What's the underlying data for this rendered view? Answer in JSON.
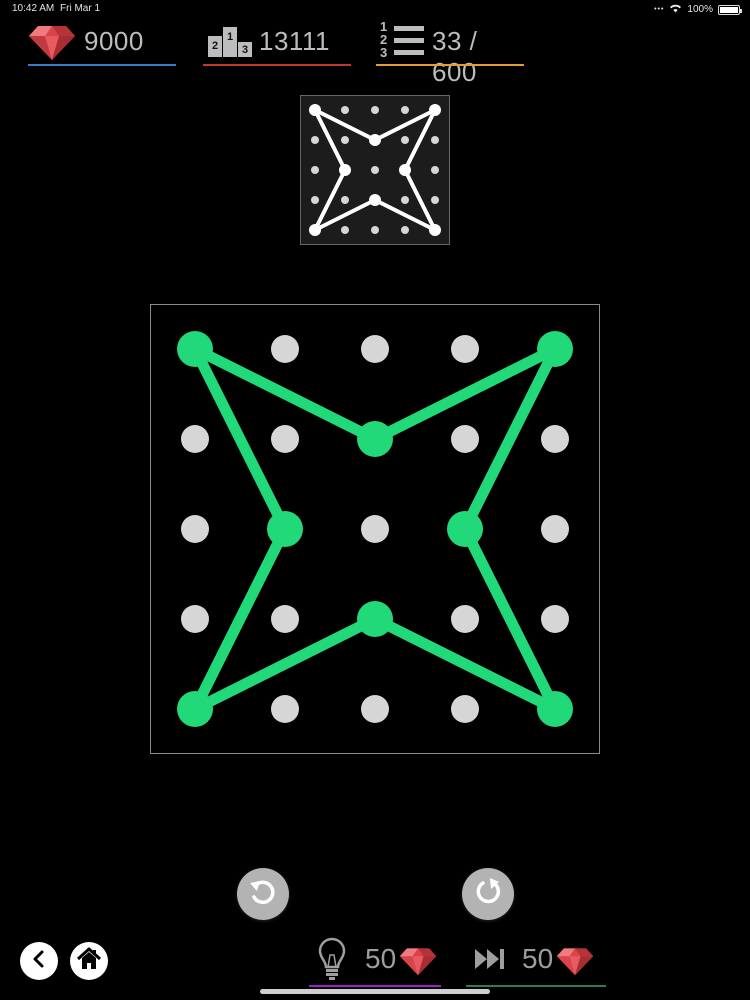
{
  "status_bar": {
    "time": "10:42 AM",
    "date": "Fri Mar 1",
    "battery": "100%",
    "battery_level": 1.0
  },
  "stats": {
    "gems": {
      "value": "9000",
      "underline_color": "#3a78c8"
    },
    "score": {
      "value": "13111",
      "underline_color": "#c0392b",
      "podium": [
        "2",
        "1",
        "3"
      ]
    },
    "level": {
      "value": "33 / 600",
      "underline_color": "#e0a030",
      "list_numbers": [
        "1",
        "2",
        "3"
      ]
    }
  },
  "puzzle": {
    "grid_size": 5,
    "dot_color": "#d6d6d6",
    "line_color": "#22d97a",
    "preview_line_color": "#ffffff",
    "shape": [
      [
        0,
        0
      ],
      [
        2,
        1
      ],
      [
        4,
        0
      ],
      [
        3,
        2
      ],
      [
        4,
        4
      ],
      [
        2,
        3
      ],
      [
        0,
        4
      ],
      [
        1,
        2
      ],
      [
        0,
        0
      ]
    ]
  },
  "controls": {
    "undo": "undo-icon",
    "reset": "reset-icon",
    "back": "chevron-left-icon",
    "home": "home-icon"
  },
  "hint": {
    "cost": "50",
    "icon": "lightbulb-icon",
    "underline_color": "#a020c8"
  },
  "skip": {
    "cost": "50",
    "icon": "fast-forward-icon",
    "underline_color": "#2e7d4f"
  },
  "colors": {
    "gem": "#e0474c",
    "background": "#000000"
  }
}
